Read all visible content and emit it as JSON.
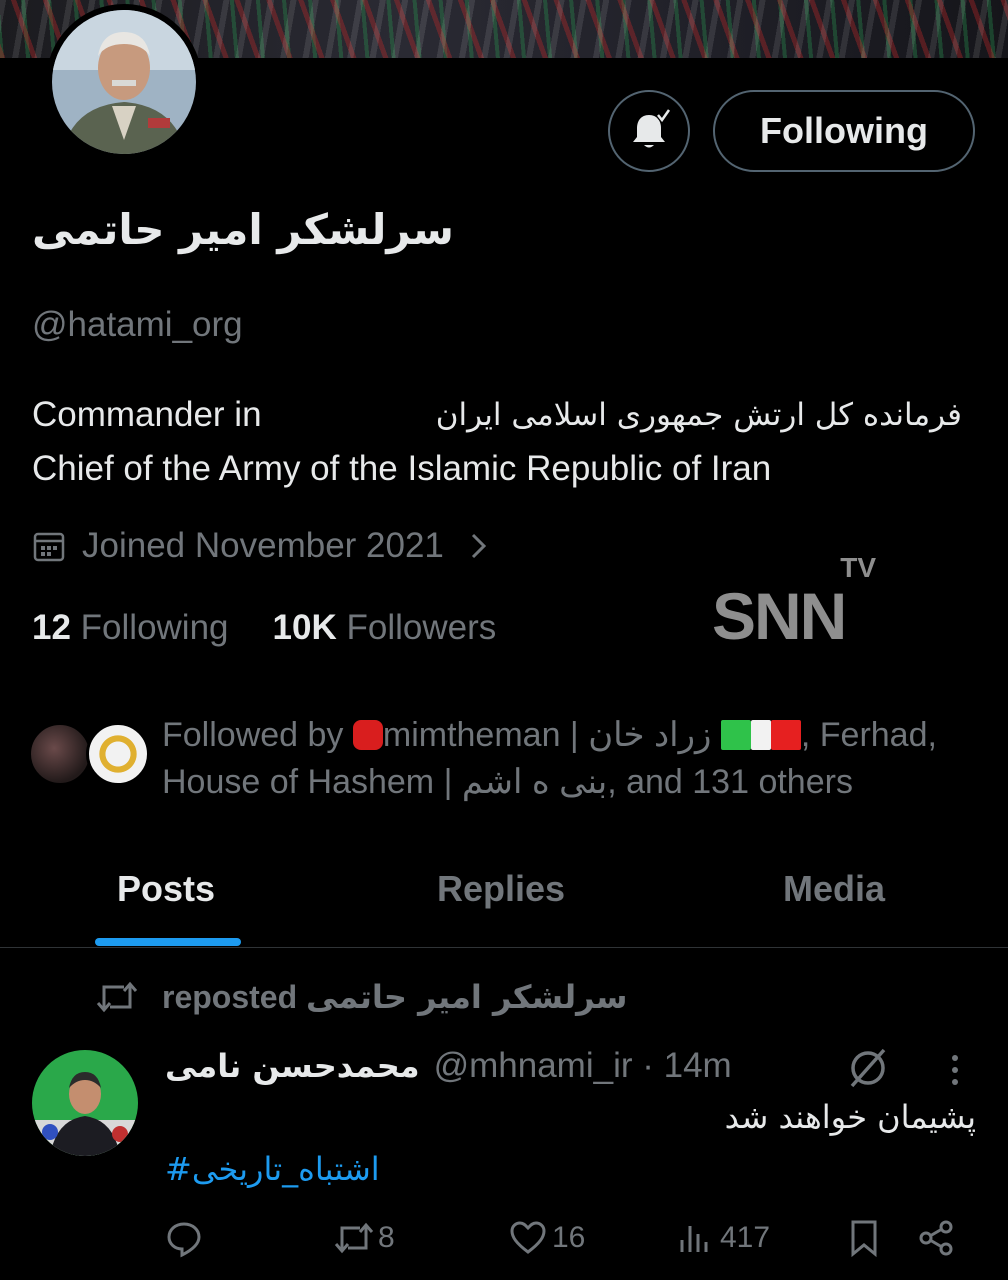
{
  "profile": {
    "display_name": "سرلشکر امیر حاتمی",
    "handle": "@hatami_org",
    "bio_en_line1": "Commander in",
    "bio_fa": "فرمانده کل ارتش جمهوری اسلامی ایران",
    "bio_en_line2": "Chief of the Army of the Islamic Republic of Iran",
    "joined": "Joined November 2021",
    "following_count": "12",
    "following_label": "Following",
    "followers_count": "10K",
    "followers_label": "Followers"
  },
  "buttons": {
    "following": "Following",
    "bell_icon": "bell-check-icon"
  },
  "watermark": {
    "main": "SNN",
    "sub": "TV"
  },
  "followed_by": {
    "prefix": "Followed by ",
    "user1": "mimtheman | زراد خان ",
    "user2": ", Ferhad,",
    "user3": "House of Hashem | بنی ه اشم",
    "suffix": ", and 131 others"
  },
  "tabs": [
    "Posts",
    "Replies",
    "Media"
  ],
  "post": {
    "repost_label": "reposted",
    "reposter": "سرلشکر امیر حاتمی",
    "author_name": "محمدحسن نامی",
    "author_meta": "@mhnami_ir · 14m",
    "text": "پشیمان خواهند شد",
    "hashtag": "اشتباه_تاریخی#",
    "reposts": "8",
    "likes": "16",
    "views": "417"
  },
  "colors": {
    "background": "#000000",
    "text": "#e7e9ea",
    "muted": "#71767b",
    "accent": "#1d9bf0",
    "border": "#536471"
  }
}
